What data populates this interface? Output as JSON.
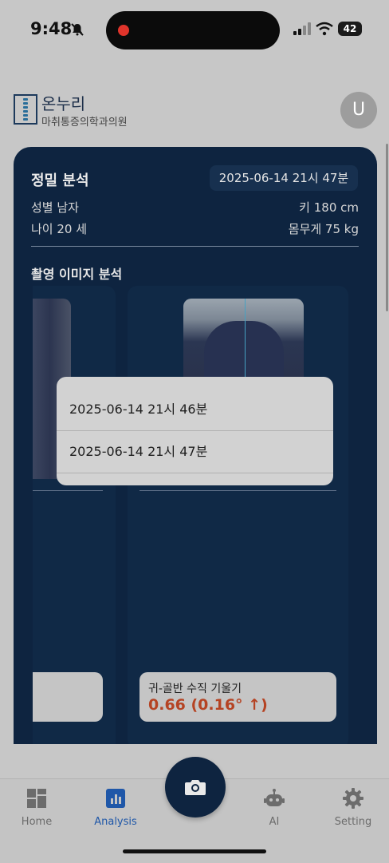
{
  "status_bar": {
    "time": "9:48",
    "battery": "42"
  },
  "header": {
    "brand": "온누리",
    "brand_sub": "마취통증의학과의원",
    "avatar_initial": "U"
  },
  "analysis": {
    "title": "정밀 분석",
    "selected_date": "2025-06-14 21시 47분",
    "gender": "성별 남자",
    "height": "키 180 cm",
    "age": "나이 20 세",
    "weight": "몸무게 75 kg",
    "section_title": "촬영 이미지 분석",
    "metric_label": "귀-골반 수직 기울기",
    "metric_value": "0.66 (0.16° ↑)"
  },
  "date_menu": {
    "options": [
      "2025-06-14 21시 46분",
      "2025-06-14 21시 47분"
    ]
  },
  "tabs": [
    {
      "label": "Home",
      "icon": "grid-icon"
    },
    {
      "label": "Analysis",
      "icon": "bar-chart-icon",
      "active": true
    },
    {
      "label": "AI",
      "icon": "robot-icon"
    },
    {
      "label": "Setting",
      "icon": "gear-icon"
    }
  ],
  "colors": {
    "accent": "#1f57a8",
    "card": "#0e2440",
    "metric_value": "#b54323"
  }
}
